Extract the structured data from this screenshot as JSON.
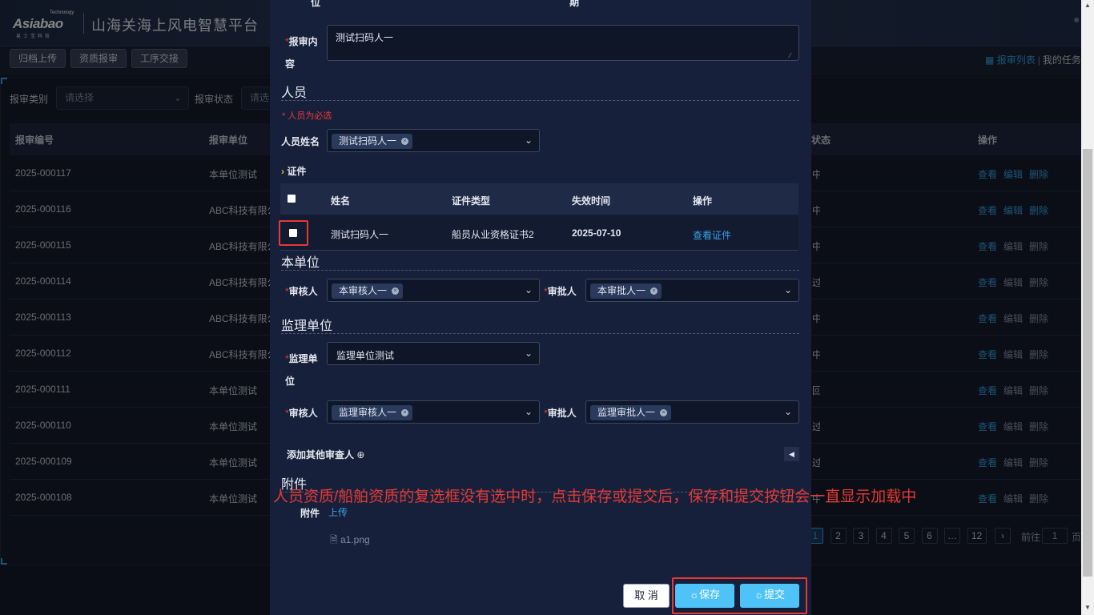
{
  "header": {
    "logo_text": "Asiabao",
    "logo_tech": "Technology",
    "logo_sub": "易士宝科技",
    "site_title": "山海关海上风电智慧平台"
  },
  "toolbar": {
    "buttons": [
      "归档上传",
      "资质报审",
      "工序交接"
    ],
    "report_list_label": "报审列表",
    "separator": "|",
    "my_tasks_label": "我的任务"
  },
  "filters": {
    "type_label": "报审类别",
    "type_placeholder": "请选择",
    "status_label": "报审状态",
    "status_placeholder": "请选择"
  },
  "table": {
    "headers": {
      "code": "报审编号",
      "unit": "报审单位",
      "status": "状态",
      "ops": "操作"
    },
    "rows": [
      {
        "code": "2025-000117",
        "unit": "本单位测试",
        "status": "中",
        "ops": [
          {
            "label": "查看",
            "active": true
          },
          {
            "label": "编辑",
            "active": true
          },
          {
            "label": "删除",
            "active": true
          }
        ]
      },
      {
        "code": "2025-000116",
        "unit": "ABC科技有限公司",
        "status": "中",
        "ops": [
          {
            "label": "查看",
            "active": true
          },
          {
            "label": "编辑",
            "active": true
          },
          {
            "label": "删除",
            "active": true
          }
        ]
      },
      {
        "code": "2025-000115",
        "unit": "ABC科技有限公司",
        "status": "中",
        "ops": [
          {
            "label": "查看",
            "active": true
          },
          {
            "label": "编辑",
            "active": false
          },
          {
            "label": "删除",
            "active": false
          }
        ]
      },
      {
        "code": "2025-000114",
        "unit": "ABC科技有限公司",
        "status": "过",
        "ops": [
          {
            "label": "查看",
            "active": true
          },
          {
            "label": "编辑",
            "active": false
          },
          {
            "label": "删除",
            "active": false
          }
        ]
      },
      {
        "code": "2025-000113",
        "unit": "ABC科技有限公司",
        "status": "中",
        "ops": [
          {
            "label": "查看",
            "active": true
          },
          {
            "label": "编辑",
            "active": false
          },
          {
            "label": "删除",
            "active": false
          }
        ]
      },
      {
        "code": "2025-000112",
        "unit": "ABC科技有限公司",
        "status": "中",
        "ops": [
          {
            "label": "查看",
            "active": true
          },
          {
            "label": "编辑",
            "active": false
          },
          {
            "label": "删除",
            "active": false
          }
        ]
      },
      {
        "code": "2025-000111",
        "unit": "本单位测试",
        "status": "回",
        "ops": [
          {
            "label": "查看",
            "active": true
          },
          {
            "label": "编辑",
            "active": false
          },
          {
            "label": "删除",
            "active": false
          }
        ]
      },
      {
        "code": "2025-000110",
        "unit": "本单位测试",
        "status": "过",
        "ops": [
          {
            "label": "查看",
            "active": true
          },
          {
            "label": "编辑",
            "active": false
          },
          {
            "label": "删除",
            "active": false
          }
        ]
      },
      {
        "code": "2025-000109",
        "unit": "本单位测试",
        "status": "过",
        "ops": [
          {
            "label": "查看",
            "active": true
          },
          {
            "label": "编辑",
            "active": false
          },
          {
            "label": "删除",
            "active": false
          }
        ]
      },
      {
        "code": "2025-000108",
        "unit": "本单位测试",
        "status": "中",
        "ops": [
          {
            "label": "查看",
            "active": true
          },
          {
            "label": "编辑",
            "active": false
          },
          {
            "label": "删除",
            "active": false
          }
        ]
      }
    ]
  },
  "pagination": {
    "pages": [
      "1",
      "2",
      "3",
      "4",
      "5",
      "6",
      "…",
      "12"
    ],
    "current": "1",
    "next": "›",
    "goto_label": "前往",
    "goto_value": "1",
    "page_suffix": "页"
  },
  "modal": {
    "top_label_left": "位",
    "top_label_right": "期",
    "content_label": "报审内容",
    "content_value": "测试扫码人一",
    "personnel_section": "人员",
    "personnel_required_note": "* 人员为必选",
    "personnel_name_label": "人员姓名",
    "personnel_tag": "测试扫码人一",
    "cert_toggle": "证件",
    "cert_table": {
      "headers": [
        "姓名",
        "证件类型",
        "失效时间",
        "操作"
      ],
      "row": {
        "name": "测试扫码人一",
        "type": "船员从业资格证书2",
        "expiry": "2025-07-10",
        "action": "查看证件"
      }
    },
    "own_unit_section": "本单位",
    "reviewer_label": "审核人",
    "approver_label": "审批人",
    "own_reviewer_tag": "本审核人一",
    "own_approver_tag": "本审批人一",
    "supervisor_section": "监理单位",
    "supervisor_unit_label": "监理单位",
    "supervisor_unit_value": "监理单位测试",
    "sup_reviewer_tag": "监理审核人一",
    "sup_approver_tag": "监理审批人一",
    "add_reviewer_label": "添加其他审查人",
    "attachment_section": "附件",
    "attachment_label": "附件",
    "upload_label": "上传",
    "file_name": "a1.png",
    "cancel_label": "取 消",
    "save_label": "保存",
    "submit_label": "提交"
  },
  "annotation": "人员资质/船舶资质的复选框没有选中时，点击保存或提交后，保存和提交按钮会一直显示加载中",
  "colors": {
    "accent": "#39a2e6",
    "required": "#e53935",
    "annotation": "#e53935",
    "primary_button": "#4fc3f7"
  }
}
